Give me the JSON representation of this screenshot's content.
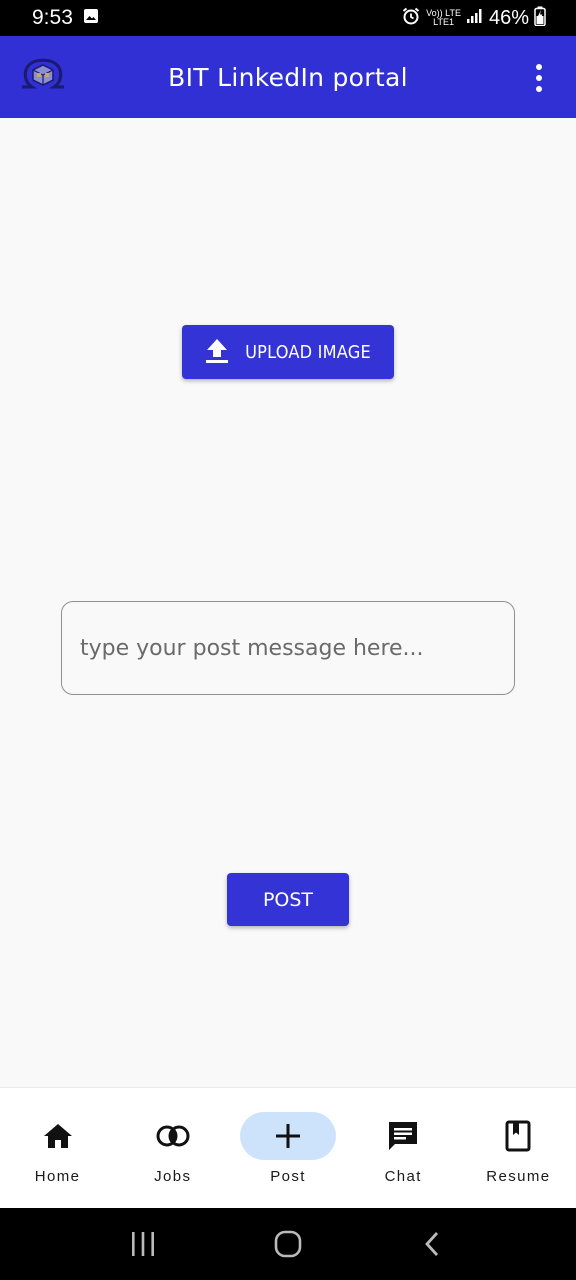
{
  "status_bar": {
    "time": "9:53",
    "network_top": "Vo)) LTE",
    "network_bottom": "LTE1",
    "battery": "46%"
  },
  "app_bar": {
    "title": "BIT LinkedIn portal",
    "logo_icon": "omega-cube-logo",
    "overflow_icon": "more-vert-icon",
    "color": "#3030d4"
  },
  "upload": {
    "label": "UPLOAD IMAGE",
    "icon": "upload-icon"
  },
  "post_field": {
    "value": "",
    "placeholder": "type your post message here..."
  },
  "post_button": {
    "label": "POST"
  },
  "bottom_nav": {
    "items": [
      {
        "label": "Home",
        "icon": "home-icon",
        "active": false
      },
      {
        "label": "Jobs",
        "icon": "jobs-rings-icon",
        "active": false
      },
      {
        "label": "Post",
        "icon": "plus-icon",
        "active": true
      },
      {
        "label": "Chat",
        "icon": "chat-icon",
        "active": false
      },
      {
        "label": "Resume",
        "icon": "bookmark-book-icon",
        "active": false
      }
    ],
    "active_color": "#cde3fb"
  },
  "system_nav": {
    "icons": [
      "recents-icon",
      "home-circle-icon",
      "back-icon"
    ]
  }
}
